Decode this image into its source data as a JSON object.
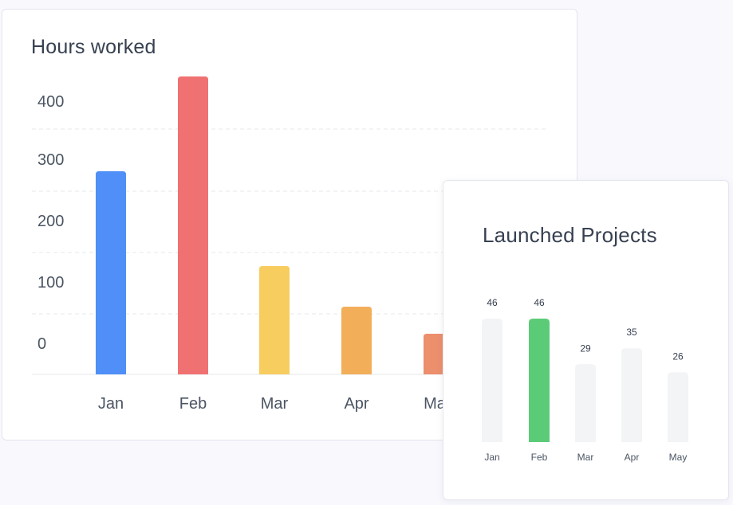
{
  "colors": {
    "grid": "#e5e7eb",
    "baseline": "#e5e7eb",
    "track": "#f3f4f6",
    "highlight": "#5ccb78",
    "label_default": "#374151",
    "tick": "#4b5563"
  },
  "chart_data": [
    {
      "type": "bar",
      "title": "Hours worked",
      "categories": [
        "Jan",
        "Feb",
        "Mar",
        "Apr",
        "May"
      ],
      "values": [
        300,
        440,
        160,
        100,
        60
      ],
      "yticks": [
        "400",
        "300",
        "200",
        "100",
        "0"
      ],
      "colors": [
        "#4f8ff7",
        "#f07171",
        "#f8cd5f",
        "#f3ae5a",
        "#ec8f6c"
      ],
      "grid": true,
      "xlabel": "",
      "ylabel": ""
    },
    {
      "type": "bar",
      "title": "Launched Projects",
      "categories": [
        "Jan",
        "Feb",
        "Mar",
        "Apr",
        "May"
      ],
      "values": [
        46,
        46,
        29,
        35,
        26
      ],
      "highlight_index": 1,
      "value_labels": true,
      "grid": false,
      "xlabel": "",
      "ylabel": ""
    }
  ]
}
